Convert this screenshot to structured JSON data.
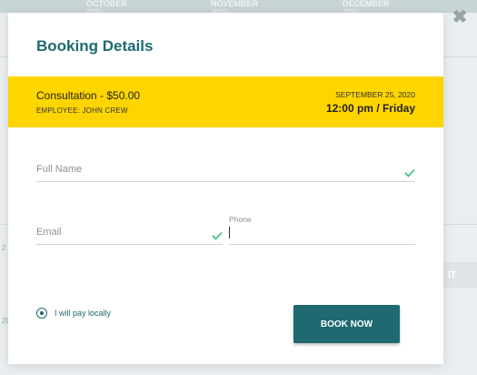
{
  "background": {
    "months": [
      {
        "name": "OCTOBER",
        "year": "2020"
      },
      {
        "name": "NOVEMBER",
        "year": "2020"
      },
      {
        "name": "DECEMBER",
        "year": "2020"
      }
    ],
    "side_button_label": "IT",
    "close_glyph": "✖",
    "side_text_1": "2",
    "side_text_2": "20"
  },
  "modal": {
    "title": "Booking Details",
    "banner": {
      "service": "Consultation - $50.00",
      "employee": "EMPLOYEE: JOHN CREW",
      "date": "SEPTEMBER 25, 2020",
      "time": "12:00 pm / Friday"
    },
    "form": {
      "full_name": {
        "placeholder": "Full Name",
        "value": ""
      },
      "email": {
        "placeholder": "Email",
        "value": ""
      },
      "phone": {
        "label": "Phone",
        "value": ""
      }
    },
    "payment_option": "I will pay locally",
    "submit_label": "BOOK NOW"
  },
  "colors": {
    "accent": "#1e6a70",
    "banner": "#ffd500",
    "valid_check": "#2bbf7a"
  }
}
